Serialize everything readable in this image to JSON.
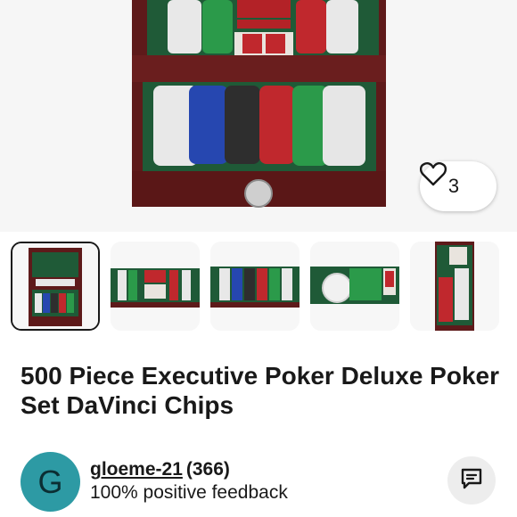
{
  "listing": {
    "watch_count": "3",
    "title": "500 Piece Executive Poker Deluxe Poker Set DaVinci Chips"
  },
  "gallery": {
    "selected_index": 0,
    "thumbnail_count": 5
  },
  "seller": {
    "avatar_initial": "G",
    "name": "gloeme-21",
    "feedback_count": "(366)",
    "feedback_text": "100% positive feedback"
  },
  "icons": {
    "watch": "heart-outline-icon",
    "message": "chat-bubble-icon"
  },
  "colors": {
    "avatar_bg": "#2d9aa4",
    "wood": "#5e1a1a",
    "felt": "#1f5a37"
  }
}
